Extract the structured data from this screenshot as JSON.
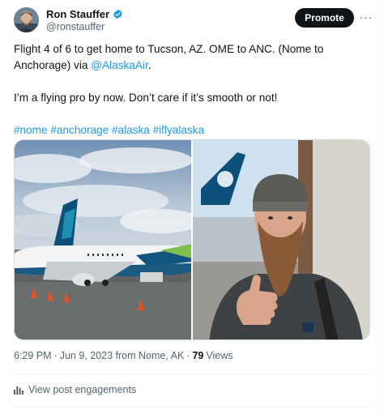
{
  "author": {
    "name": "Ron Stauffer",
    "handle": "@ronstauffer",
    "verified_icon": "verified-badge-icon"
  },
  "header": {
    "promote_label": "Promote",
    "more_icon": "more-options-icon",
    "more_glyph": "···"
  },
  "tweet": {
    "line1_a": "Flight 4 of 6 to get home to Tucson, AZ. OME to ANC. (Nome to Anchorage) via ",
    "mention": "@AlaskaAir",
    "line1_b": ".",
    "line2": "I’m a flying pro by now. Don’t care if it’s smooth or not!",
    "hashtags": [
      "#nome",
      "#anchorage",
      "#alaska",
      "#iflyalaska"
    ]
  },
  "media": {
    "left_photo": "alaska-airlines-plane-photo",
    "right_photo": "selfie-thumbs-up-photo"
  },
  "meta": {
    "time": "6:29 PM",
    "sep1": "·",
    "date_location": "Jun 9, 2023 from Nome, AK",
    "sep2": "·",
    "views_count": "79",
    "views_label": "Views"
  },
  "engagements": {
    "label": "View post engagements",
    "icon": "analytics-bars-icon"
  },
  "colors": {
    "accent": "#1d9bf0",
    "text": "#0f1419",
    "muted": "#536471",
    "promote_bg": "#0f1419"
  }
}
